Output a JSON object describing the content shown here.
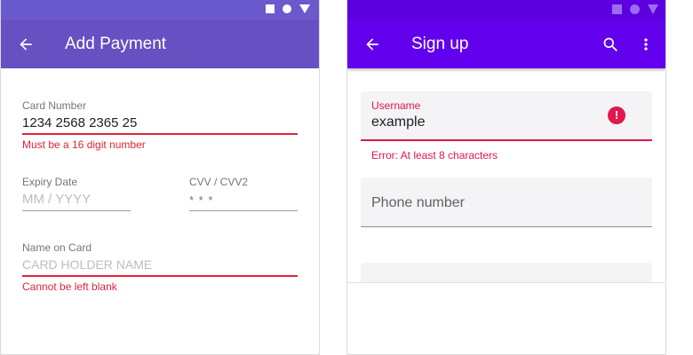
{
  "left_screen": {
    "colors": {
      "status_bar": "#6a5acd",
      "app_bar": "#6750c2",
      "error": "#e3213a"
    },
    "title": "Add Payment",
    "back_icon": "arrow-left-icon",
    "fields": {
      "card_number": {
        "label": "Card Number",
        "value": "1234 2568 2365 25",
        "error": "Must be a 16 digit number"
      },
      "expiry": {
        "label": "Expiry Date",
        "placeholder": "MM / YYYY"
      },
      "cvv": {
        "label": "CVV / CVV2",
        "placeholder": "* * *"
      },
      "name": {
        "label": "Name on Card",
        "placeholder": "CARD HOLDER NAME",
        "error": "Cannot be left blank"
      }
    }
  },
  "right_screen": {
    "colors": {
      "status_bar": "#5c00e0",
      "app_bar": "#6200ee",
      "error": "#e3164d"
    },
    "title": "Sign up",
    "back_icon": "arrow-left-icon",
    "action_icons": [
      "search-icon",
      "more-vert-icon"
    ],
    "fields": {
      "username": {
        "label": "Username",
        "value": "example",
        "error": "Error: At least 8 characters"
      },
      "phone": {
        "label": "Phone number"
      }
    }
  }
}
